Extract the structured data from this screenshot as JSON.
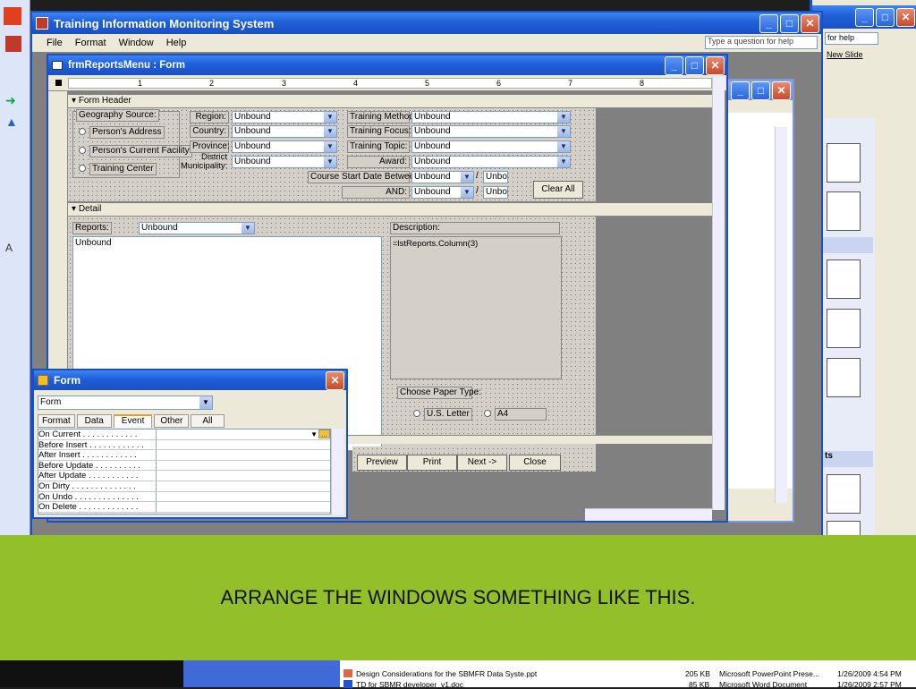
{
  "app": {
    "title": "Training Information Monitoring System",
    "help_placeholder": "Type a question for help"
  },
  "menu": [
    "File",
    "Format",
    "Window",
    "Help"
  ],
  "right_panel": {
    "help_text": "for help",
    "new_slide": "New Slide",
    "section_label": "ts"
  },
  "form_window": {
    "title": "frmReportsMenu : Form"
  },
  "ruler": [
    "1",
    "2",
    "3",
    "4",
    "5",
    "6",
    "7",
    "8"
  ],
  "sections": {
    "header": "Form Header",
    "detail": "Detail"
  },
  "geo": {
    "label": "Geography Source:",
    "options": [
      "Person's Address",
      "Person's Current Facility",
      "Training Center"
    ]
  },
  "filters": {
    "left": [
      {
        "label": "Region:",
        "value": "Unbound"
      },
      {
        "label": "Country:",
        "value": "Unbound"
      },
      {
        "label": "Province:",
        "value": "Unbound"
      },
      {
        "label": "District Municipality:",
        "value": "Unbound"
      }
    ],
    "right": [
      {
        "label": "Training Method:",
        "value": "Unbound"
      },
      {
        "label": "Training Focus:",
        "value": "Unbound"
      },
      {
        "label": "Training Topic:",
        "value": "Unbound"
      },
      {
        "label": "Award:",
        "value": "Unbound"
      }
    ],
    "date_label": "Course Start Date Between:",
    "date_value": "Unbound",
    "date_value2": "Unbo",
    "and_label": "AND:",
    "and_value": "Unbound",
    "and_value2": "Unbo",
    "slash": "/",
    "clear_all": "Clear All"
  },
  "detail": {
    "reports_label": "Reports:",
    "reports_value": "Unbound",
    "list_value": "Unbound",
    "description_label": "Description:",
    "description_value": "=lstReports.Column(3)",
    "paper_label": "Choose Paper Type:",
    "paper_options": [
      "U.S. Letter",
      "A4"
    ]
  },
  "buttons": {
    "preview": "Preview",
    "print": "Print",
    "next": "Next ->",
    "close": "Close"
  },
  "property_sheet": {
    "title": "Form",
    "selector": "Form",
    "tabs": [
      "Format",
      "Data",
      "Event",
      "Other",
      "All"
    ],
    "active_tab": "Event",
    "rows": [
      "On Current . . . . . . . . . . . .",
      "Before Insert . . . . . . . . . . . .",
      "After Insert . . . . . . . . . . . .",
      "Before Update . . . . . . . . . .",
      "After Update . . . . . . . . . . .",
      "On Dirty . . . . . . . . . . . . . .",
      "On Undo . . . . . . . . . . . . . .",
      "On Delete . . . . . . . . . . . . ."
    ]
  },
  "explorer": {
    "files": [
      {
        "name": "Design Considerations for the SBMFR Data Syste.ppt",
        "size": "205 KB",
        "type": "Microsoft PowerPoint Prese...",
        "date": "1/26/2009 4:54 PM"
      },
      {
        "name": "TD for SBMR developer_v1.doc",
        "size": "85 KB",
        "type": "Microsoft Word Document",
        "date": "1/26/2009 2:57 PM"
      }
    ]
  },
  "caption": "ARRANGE THE WINDOWS SOMETHING LIKE THIS.",
  "colors": {
    "caption_bg": "#93bf2a",
    "titlebar": "#2563d8",
    "design_bg": "#808080"
  }
}
